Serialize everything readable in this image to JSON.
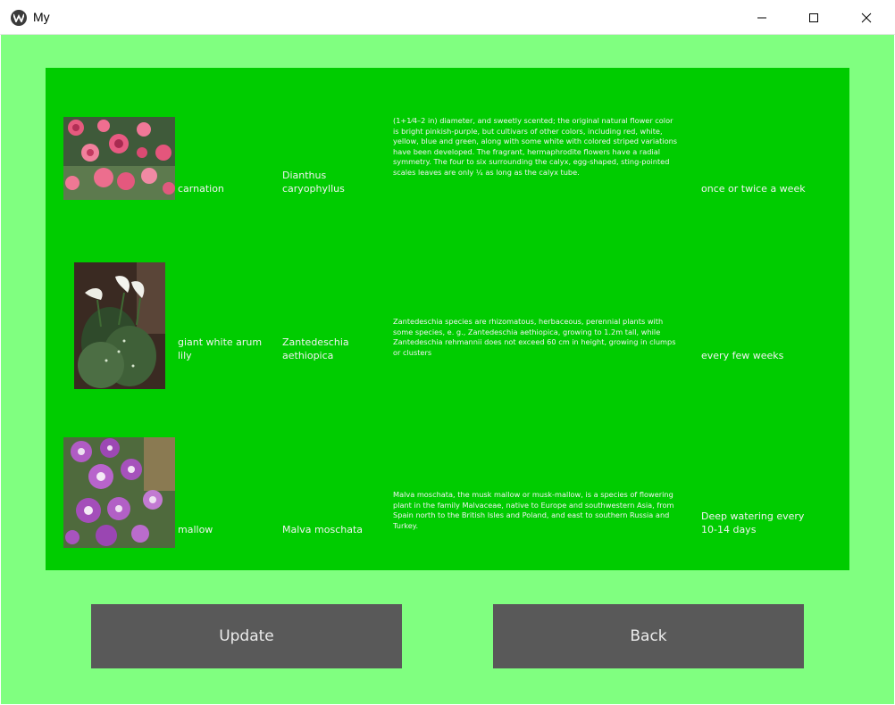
{
  "window": {
    "title": "My",
    "minimize_icon": "minimize-icon",
    "maximize_icon": "maximize-icon",
    "close_icon": "close-icon"
  },
  "plants": [
    {
      "image": "carnation-photo",
      "name": "carnation",
      "scientific_name": "Dianthus caryophyllus",
      "description": "(1+1⁄4–2 in) diameter, and sweetly scented; the original natural flower color is bright pinkish-purple, but cultivars of other colors, including red, white, yellow, blue and green, along with some white with colored striped variations have been developed. The fragrant, hermaphrodite flowers have a radial symmetry. The four to six surrounding the calyx, egg-shaped, sting-pointed scales leaves are only ¼ as long as the calyx tube.",
      "watering": "once or twice a week"
    },
    {
      "image": "giant-white-arum-lily-photo",
      "name": "giant white arum lily",
      "scientific_name": "Zantedeschia aethiopica",
      "description": "Zantedeschia species are rhizomatous, herbaceous, perennial plants with some species, e. g., Zantedeschia aethiopica, growing to 1.2m tall, while Zantedeschia rehmannii does not exceed 60 cm in height, growing in clumps or clusters",
      "watering": "every few weeks"
    },
    {
      "image": "mallow-photo",
      "name": "mallow",
      "scientific_name": "Malva moschata",
      "description": "Malva moschata, the musk mallow or musk-mallow, is a species of flowering plant in the family Malvaceae, native to Europe and southwestern Asia, from Spain north to the British Isles and Poland, and east to southern Russia and Turkey.",
      "watering": "Deep watering every 10-14 days"
    }
  ],
  "buttons": {
    "update": "Update",
    "back": "Back"
  },
  "colors": {
    "window_background": "#80ff80",
    "table_background": "#00cc00",
    "button_background": "#595959",
    "text": "#f2f2f2"
  }
}
